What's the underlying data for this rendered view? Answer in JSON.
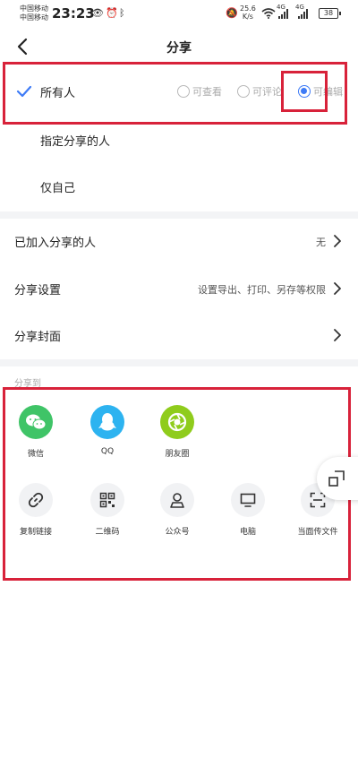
{
  "status_bar": {
    "carrier_1": "中国移动",
    "carrier_2": "中国移动",
    "time": "23:23",
    "net_speed_value": "25.6",
    "net_speed_unit": "K/s",
    "signal_1": "4G",
    "signal_2": "4G",
    "battery": "38"
  },
  "header": {
    "title": "分享"
  },
  "permissions": {
    "everyone": "所有人",
    "specified": "指定分享的人",
    "only_me": "仅自己",
    "modes": [
      {
        "label": "可查看",
        "selected": false
      },
      {
        "label": "可评论",
        "selected": false
      },
      {
        "label": "可编辑",
        "selected": true
      }
    ]
  },
  "settings": {
    "joined": {
      "label": "已加入分享的人",
      "value": "无"
    },
    "share_settings": {
      "label": "分享设置",
      "value": "设置导出、打印、另存等权限"
    },
    "share_cover": {
      "label": "分享封面"
    }
  },
  "share_to": {
    "label": "分享到",
    "apps": [
      {
        "name": "微信",
        "color": "#3fc467"
      },
      {
        "name": "QQ",
        "color": "#2db3f0"
      },
      {
        "name": "朋友圈",
        "color": "#8fcc1c"
      }
    ],
    "tools": [
      {
        "name": "复制链接"
      },
      {
        "name": "二维码"
      },
      {
        "name": "公众号"
      },
      {
        "name": "电脑"
      },
      {
        "name": "当面传文件"
      }
    ]
  },
  "colors": {
    "accent": "#3e7bf6",
    "highlight": "#d8223a"
  }
}
